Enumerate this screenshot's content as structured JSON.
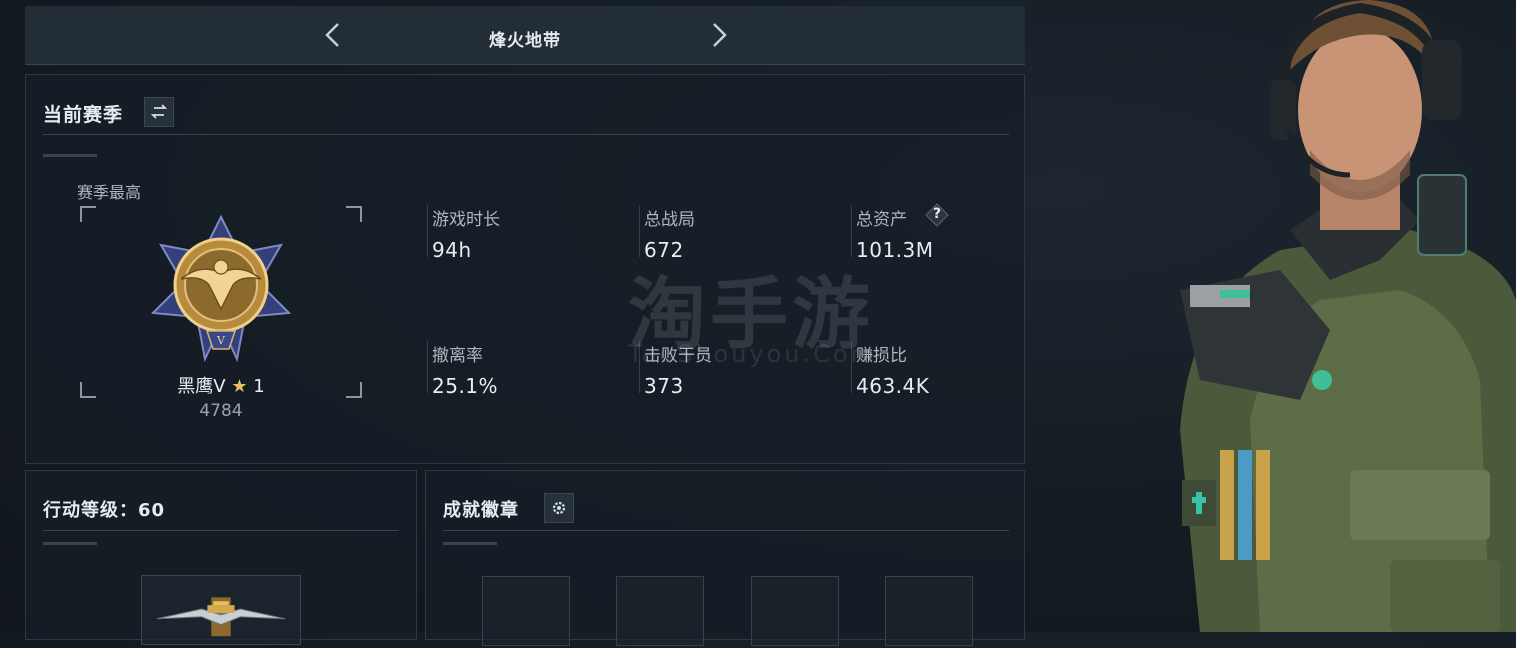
{
  "header": {
    "mode_title": "烽火地带"
  },
  "season": {
    "title": "当前赛季",
    "best_label": "赛季最高",
    "rank_name": "黑鹰V",
    "rank_stars": "1",
    "rank_score": "4784",
    "stats": [
      {
        "label": "游戏时长",
        "value": "94h"
      },
      {
        "label": "总战局",
        "value": "672"
      },
      {
        "label": "总资产",
        "value": "101.3M"
      },
      {
        "label": "撤离率",
        "value": "25.1%"
      },
      {
        "label": "击败干员",
        "value": "373"
      },
      {
        "label": "赚损比",
        "value": "463.4K"
      }
    ],
    "help_symbol": "?"
  },
  "level": {
    "title": "行动等级：60"
  },
  "badges": {
    "title": "成就徽章"
  },
  "watermark": {
    "main": "淘手游",
    "sub": "TaoShouyou.Com"
  },
  "colors": {
    "panel_bg": "#161e26",
    "border": "#2e3943",
    "gold": "#c9a24a",
    "badge_blue": "#33407a"
  }
}
